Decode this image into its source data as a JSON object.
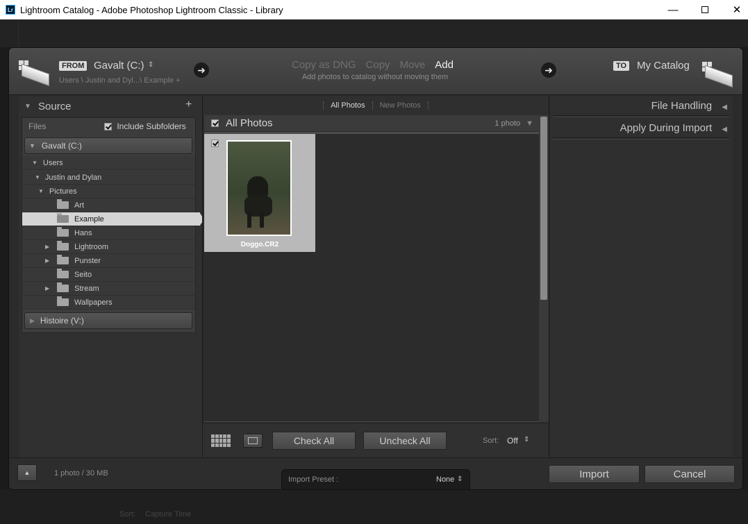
{
  "window": {
    "app_icon": "Lr",
    "title": "Lightroom Catalog - Adobe Photoshop Lightroom Classic - Library",
    "minimize_icon": "minimize-icon",
    "maximize_icon": "maximize-icon",
    "close_icon": "close-icon"
  },
  "header": {
    "from_label": "FROM",
    "from_source": "Gavalt (C:)",
    "source_path": "Users \\ Justin and Dyl...\\ Example +",
    "modes": [
      "Copy as DNG",
      "Copy",
      "Move",
      "Add"
    ],
    "active_mode": "Add",
    "mode_description": "Add photos to catalog without moving them",
    "to_label": "TO",
    "to_destination": "My Catalog"
  },
  "source_panel": {
    "title": "Source",
    "files_label": "Files",
    "include_subfolders": "Include Subfolders",
    "include_subfolders_checked": true,
    "drive_primary": "Gavalt (C:)",
    "drive_secondary": "Histoire (V:)",
    "tree": {
      "users": "Users",
      "user_folder": "Justin and Dylan",
      "pictures": "Pictures",
      "folders": [
        "Art",
        "Example",
        "Hans",
        "Lightroom",
        "Punster",
        "Seito",
        "Stream",
        "Wallpapers"
      ],
      "selected": "Example",
      "expandable": [
        "Lightroom",
        "Punster",
        "Stream"
      ]
    }
  },
  "center": {
    "filters": [
      "All Photos",
      "New Photos"
    ],
    "active_filter": "All Photos",
    "section_title": "All Photos",
    "photo_count": "1 photo",
    "thumbnails": [
      {
        "filename": "Doggo.CR2",
        "checked": true
      }
    ],
    "check_all": "Check All",
    "uncheck_all": "Uncheck All",
    "sort_label": "Sort:",
    "sort_value": "Off"
  },
  "right_panel": {
    "file_handling": "File Handling",
    "apply_during_import": "Apply During Import"
  },
  "footer": {
    "summary": "1 photo / 30 MB",
    "import_preset_label": "Import Preset :",
    "import_preset_value": "None",
    "import_button": "Import",
    "cancel_button": "Cancel"
  },
  "background": {
    "sort_label": "Sort:",
    "sort_value": "Capture Time"
  },
  "colors": {
    "dialog_bg": "#2b2b2b",
    "selected_row": "#d4d4d4",
    "active_mode": "#f2f2f2"
  }
}
